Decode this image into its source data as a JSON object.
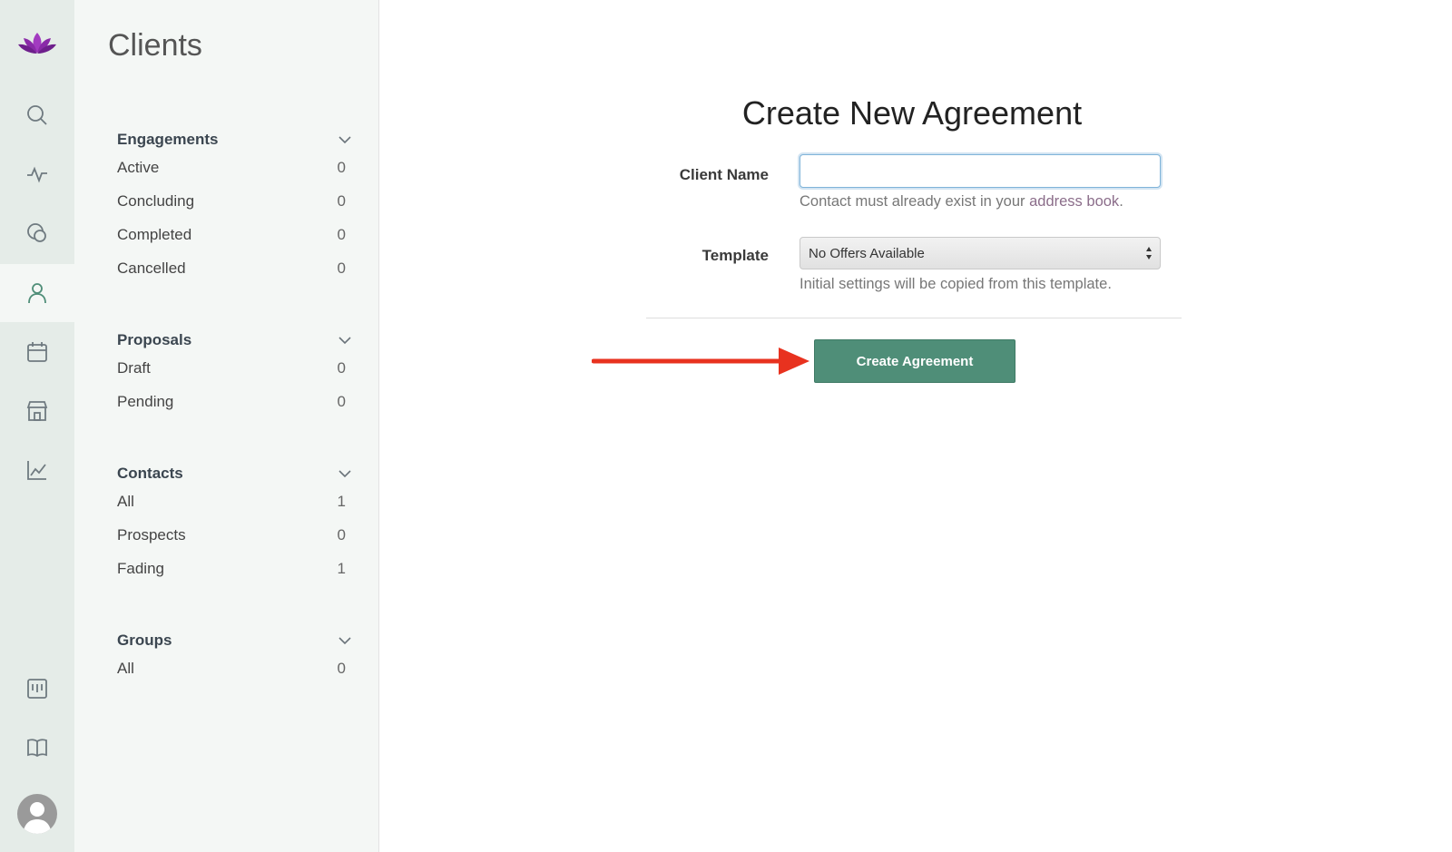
{
  "rail": {
    "logo": "lotus-logo",
    "icons": [
      "search-icon",
      "activity-icon",
      "chat-icon",
      "person-icon",
      "calendar-icon",
      "store-icon",
      "chart-icon",
      "board-icon",
      "book-icon"
    ],
    "active": "person-icon"
  },
  "sidebar": {
    "title": "Clients",
    "sections": [
      {
        "title": "Engagements",
        "items": [
          {
            "label": "Active",
            "count": "0"
          },
          {
            "label": "Concluding",
            "count": "0"
          },
          {
            "label": "Completed",
            "count": "0"
          },
          {
            "label": "Cancelled",
            "count": "0"
          }
        ]
      },
      {
        "title": "Proposals",
        "items": [
          {
            "label": "Draft",
            "count": "0"
          },
          {
            "label": "Pending",
            "count": "0"
          }
        ]
      },
      {
        "title": "Contacts",
        "items": [
          {
            "label": "All",
            "count": "1"
          },
          {
            "label": "Prospects",
            "count": "0"
          },
          {
            "label": "Fading",
            "count": "1"
          }
        ]
      },
      {
        "title": "Groups",
        "items": [
          {
            "label": "All",
            "count": "0"
          }
        ]
      }
    ]
  },
  "form": {
    "title": "Create New Agreement",
    "client_name_label": "Client Name",
    "client_name_value": "",
    "client_help_prefix": "Contact must already exist in your ",
    "client_help_link": "address book",
    "client_help_suffix": ".",
    "template_label": "Template",
    "template_value": "No Offers Available",
    "template_help": "Initial settings will be copied from this template.",
    "submit_label": "Create Agreement"
  },
  "colors": {
    "accent": "#4f8e78",
    "rail_bg": "#e5ece8",
    "sidebar_bg": "#f4f7f5",
    "logo": "#9b2fb5",
    "annotation_arrow": "#e8321f"
  }
}
